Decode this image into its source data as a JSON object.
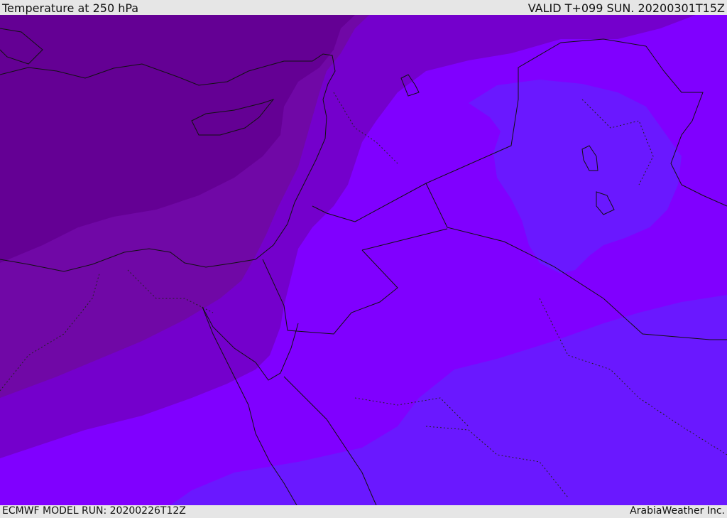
{
  "header": {
    "title": "Temperature at 250 hPa",
    "valid": "VALID T+099 SUN. 20200301T15Z"
  },
  "footer": {
    "model_run": "ECMWF MODEL RUN: 20200226T12Z",
    "credit": "ArabiaWeather Inc."
  },
  "map": {
    "field": "temperature",
    "level": "250 hPa",
    "palette": [
      "#640094",
      "#7008a6",
      "#7400cc",
      "#8000ff",
      "#6a18ff"
    ]
  }
}
